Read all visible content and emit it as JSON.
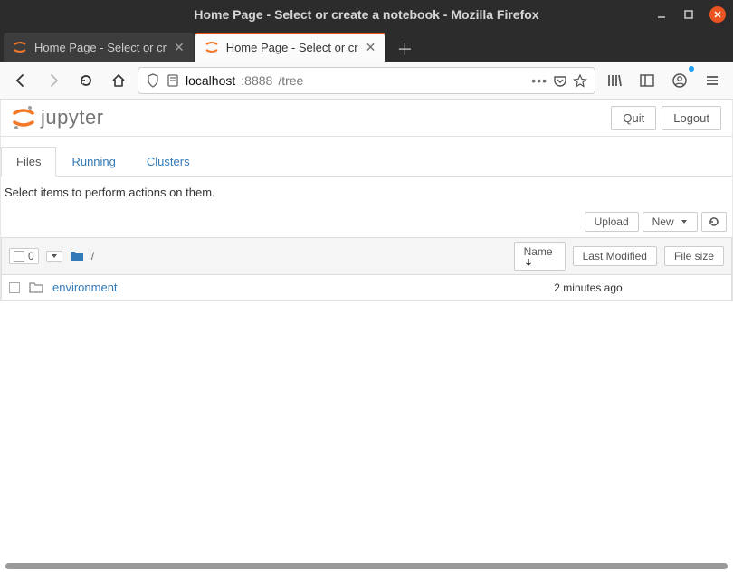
{
  "window": {
    "title": "Home Page - Select or create a notebook - Mozilla Firefox"
  },
  "browser_tabs": [
    {
      "label": "Home Page - Select or cr"
    },
    {
      "label": "Home Page - Select or cr"
    }
  ],
  "address": {
    "host": "localhost",
    "port": ":8888",
    "path": "/tree"
  },
  "jupyter": {
    "logo_text": "jupyter",
    "quit_label": "Quit",
    "logout_label": "Logout",
    "tabs": {
      "files": "Files",
      "running": "Running",
      "clusters": "Clusters"
    },
    "hint": "Select items to perform actions on them.",
    "toolbar": {
      "upload": "Upload",
      "new": "New"
    },
    "list_header": {
      "selected_count": "0",
      "breadcrumb": "/",
      "name": "Name",
      "last_modified": "Last Modified",
      "file_size": "File size"
    },
    "items": [
      {
        "name": "environment",
        "last_modified": "2 minutes ago",
        "size": ""
      }
    ]
  }
}
